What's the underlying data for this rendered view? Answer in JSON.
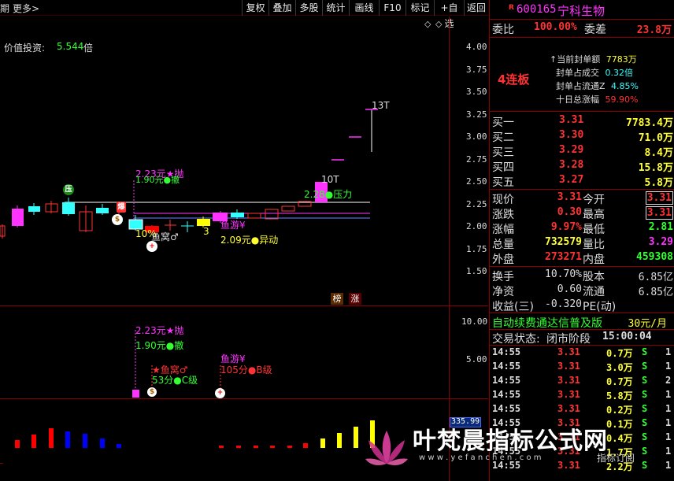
{
  "toolbar": {
    "left_text": "期",
    "more_label": "更多>",
    "buttons": [
      "复权",
      "叠加",
      "多股",
      "统计",
      "画线",
      "F10",
      "标记",
      "+自选",
      "返回"
    ]
  },
  "main_chart": {
    "indicator_label": "价值投资:",
    "indicator_value": "5.544",
    "indicator_unit": "倍",
    "y_ticks": [
      "4.00",
      "3.75",
      "3.50",
      "3.25",
      "3.00",
      "2.75",
      "2.50",
      "2.25",
      "2.00",
      "1.75",
      "1.50"
    ],
    "annotations": {
      "pressure_badge": "压",
      "explode_badge": "爆",
      "money_badge": "$",
      "plus_badge": "+",
      "throw_top": "2.23元★抛",
      "withdraw_top": "1.90元●撤",
      "pct_10": "10%",
      "fishnest": "鱼窝♂",
      "three": "3",
      "fishswim": "鱼游¥",
      "abnormal": "2.09元●异动",
      "pressure": "2.28●压力",
      "t10": "10T",
      "t13": "13T",
      "bang": "榜",
      "zhang": "涨"
    },
    "settings_icons": [
      "◇",
      "◇"
    ]
  },
  "sub_chart": {
    "y_ticks": [
      "10.00",
      "5.00"
    ],
    "throw": "2.23元★抛",
    "withdraw": "1.90元●撤",
    "fishnest": "★鱼窝♂",
    "c_level": "53分●C级",
    "fishswim": "鱼游¥",
    "b_level": "105分●B级"
  },
  "volume_chart": {
    "readout": "335.99"
  },
  "quote": {
    "code": "600165",
    "name": "宁科生物",
    "r_tag": "R",
    "weibi_label": "委比",
    "weibi_value": "100.00%",
    "weicha_label": "委差",
    "weicha_value": "23.8万",
    "lianban": "4连板",
    "seal_info": [
      {
        "label": "当前封单额",
        "value": "7783万"
      },
      {
        "label": "封单占成交",
        "value": "0.32倍"
      },
      {
        "label": "封单占流通Z",
        "value": "4.85%"
      },
      {
        "label": "十日总涨幅",
        "value": "59.90%"
      }
    ],
    "bids": [
      {
        "label": "买一",
        "price": "3.31",
        "vol": "7783.4万"
      },
      {
        "label": "买二",
        "price": "3.30",
        "vol": "71.0万"
      },
      {
        "label": "买三",
        "price": "3.29",
        "vol": "8.4万"
      },
      {
        "label": "买四",
        "price": "3.28",
        "vol": "15.8万"
      },
      {
        "label": "买五",
        "price": "3.27",
        "vol": "5.8万"
      }
    ],
    "stats": [
      {
        "l1": "现价",
        "v1": "3.31",
        "l2": "今开",
        "v2": "3.31"
      },
      {
        "l1": "涨跌",
        "v1": "0.30",
        "l2": "最高",
        "v2": "3.31"
      },
      {
        "l1": "涨幅",
        "v1": "9.97%",
        "l2": "最低",
        "v2": "2.81"
      },
      {
        "l1": "总量",
        "v1": "732579",
        "l2": "量比",
        "v2": "3.29"
      },
      {
        "l1": "外盘",
        "v1": "273271",
        "l2": "内盘",
        "v2": "459308"
      },
      {
        "l1": "换手",
        "v1": "10.70%",
        "l2": "股本",
        "v2": "6.85亿"
      },
      {
        "l1": "净资",
        "v1": "0.60",
        "l2": "流通",
        "v2": "6.85亿"
      },
      {
        "l1": "收益(三)",
        "v1": "-0.320",
        "l2": "PE(动)",
        "v2": ""
      }
    ],
    "ad_text": "自动续费通达信普及版",
    "ad_price": "30元/月",
    "trade_status_label": "交易状态:",
    "trade_status_value": "闭市阶段",
    "trade_status_time": "15:00:04",
    "trades": [
      {
        "time": "14:55",
        "price": "3.31",
        "vol": "0.7万",
        "side": "S",
        "n": "1"
      },
      {
        "time": "14:55",
        "price": "3.31",
        "vol": "3.0万",
        "side": "S",
        "n": "1"
      },
      {
        "time": "14:55",
        "price": "3.31",
        "vol": "0.7万",
        "side": "S",
        "n": "2"
      },
      {
        "time": "14:55",
        "price": "3.31",
        "vol": "5.8万",
        "side": "S",
        "n": "1"
      },
      {
        "time": "14:55",
        "price": "3.31",
        "vol": "0.2万",
        "side": "S",
        "n": "1"
      },
      {
        "time": "14:55",
        "price": "3.31",
        "vol": "0.1万",
        "side": "S",
        "n": "1"
      },
      {
        "time": "14:55",
        "price": "3.31",
        "vol": "0.4万",
        "side": "S",
        "n": "1"
      },
      {
        "time": "14:55",
        "price": "3.31",
        "vol": "1.7万",
        "side": "S",
        "n": "1"
      },
      {
        "time": "14:55",
        "price": "3.31",
        "vol": "2.2万",
        "side": "S",
        "n": "1"
      }
    ]
  },
  "watermark": {
    "title": "叶梵晨指标公式网",
    "url": "w w w . y e f a n c h e n . c o m",
    "tag": "指标订阅"
  },
  "colors": {
    "red": "#ff3333",
    "green": "#33ff33",
    "magenta": "#ff33ff",
    "cyan": "#33ffff",
    "yellow": "#ffff00",
    "blue": "#0000ff",
    "axis": "#8a0000"
  }
}
